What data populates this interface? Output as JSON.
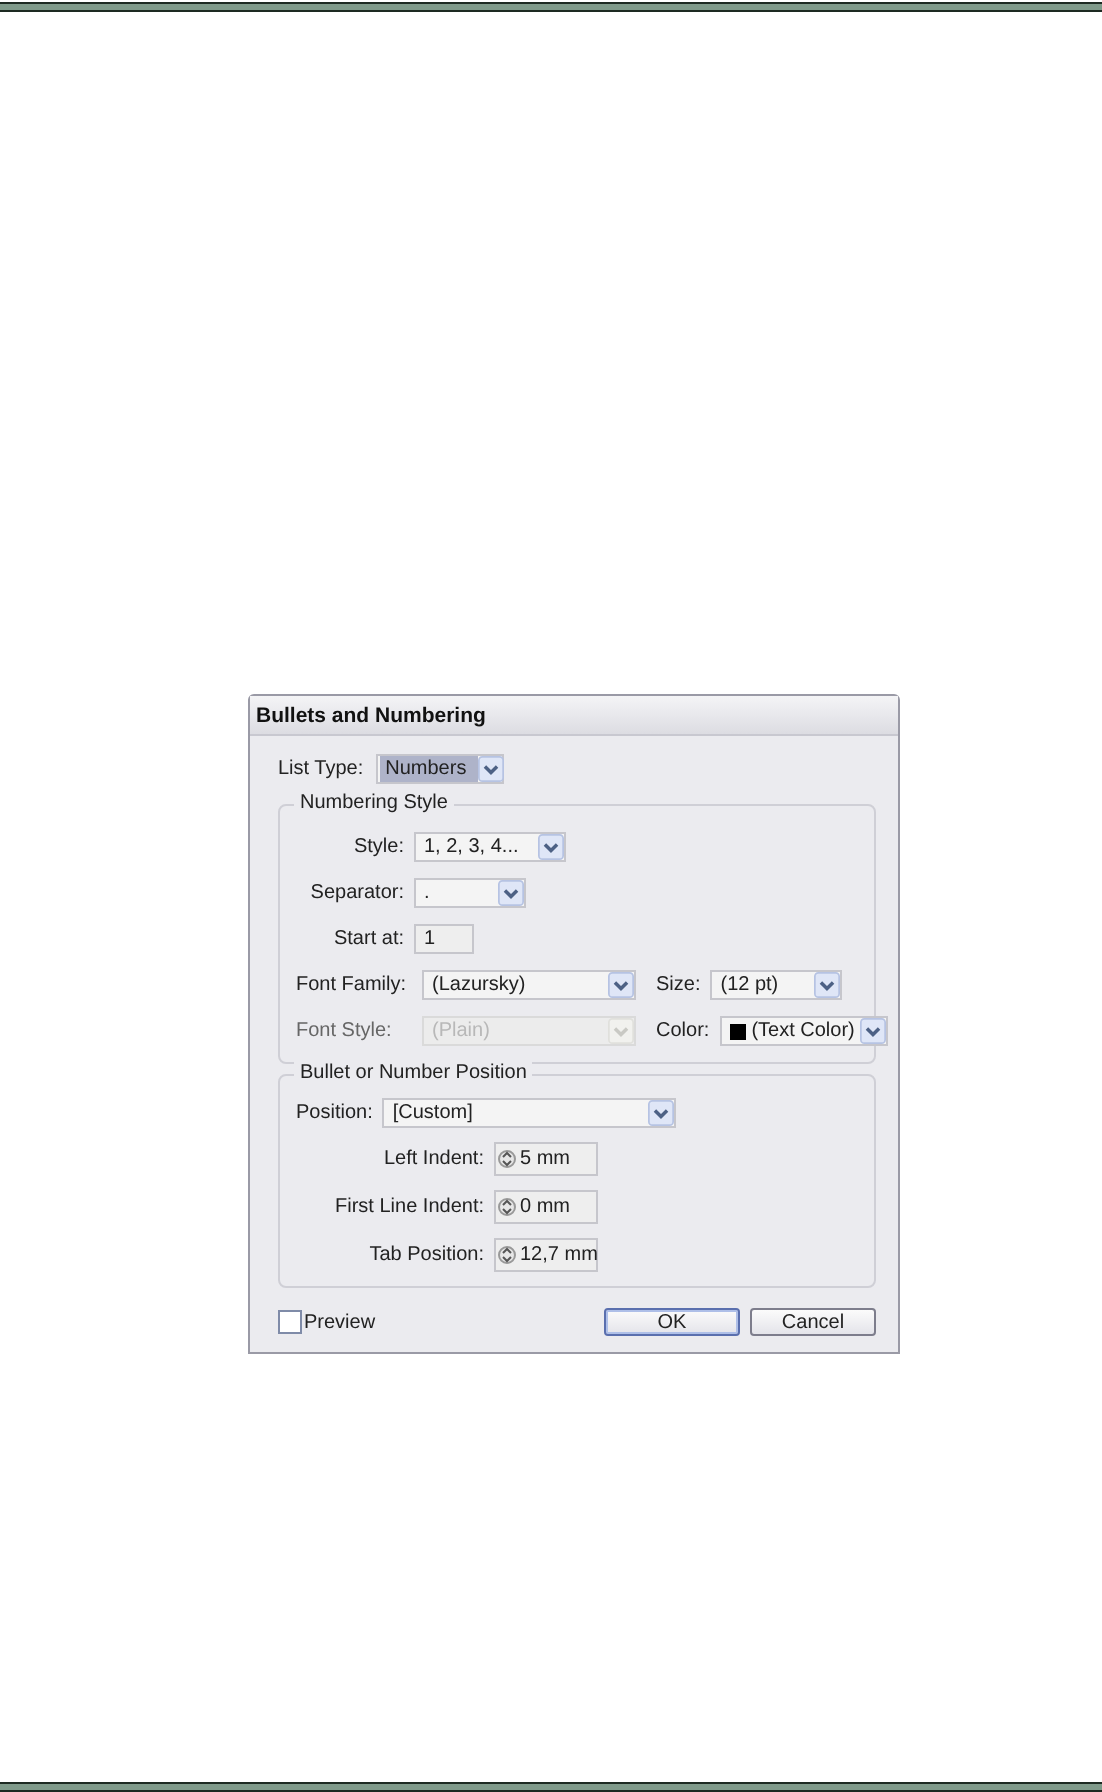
{
  "dialog": {
    "title": "Bullets and Numbering",
    "list_type": {
      "label": "List Type:",
      "value": "Numbers"
    },
    "groups": [
      {
        "title": "Numbering Style",
        "rows": [
          [
            {
              "kind": "dropdown",
              "label": "Style:",
              "value": "1, 2, 3, 4...",
              "disabled": false
            }
          ],
          [
            {
              "kind": "dropdown",
              "label": "Separator:",
              "value": ".",
              "disabled": false
            }
          ],
          [
            {
              "kind": "text",
              "label": "Start at:",
              "value": "1",
              "disabled": false
            }
          ],
          [
            {
              "kind": "dropdown",
              "label": "Font Family:",
              "value": "(Lazursky)",
              "disabled": false
            },
            {
              "kind": "dropdown",
              "label": "Size:",
              "value": "(12 pt)",
              "disabled": false
            }
          ],
          [
            {
              "kind": "dropdown",
              "label": "Font Style:",
              "value": "(Plain)",
              "disabled": true
            },
            {
              "kind": "swatch",
              "label": "Color:",
              "value": "(Text Color)",
              "color": "#000000",
              "disabled": false
            }
          ]
        ]
      },
      {
        "title": "Bullet or Number Position",
        "rows": [
          [
            {
              "kind": "dropdown",
              "label": "Position:",
              "value": "[Custom]",
              "disabled": false
            }
          ],
          [
            {
              "kind": "spinner",
              "label": "Left Indent:",
              "value": "5 mm",
              "disabled": false
            }
          ],
          [
            {
              "kind": "spinner",
              "label": "First Line Indent:",
              "value": "0 mm",
              "disabled": false
            }
          ],
          [
            {
              "kind": "spinner",
              "label": "Tab Position:",
              "value": "12,7 mm",
              "disabled": false
            }
          ]
        ]
      }
    ],
    "preview": {
      "label": "Preview",
      "checked": false
    },
    "buttons": [
      {
        "label": "OK",
        "default": true
      },
      {
        "label": "Cancel",
        "default": false
      }
    ]
  }
}
